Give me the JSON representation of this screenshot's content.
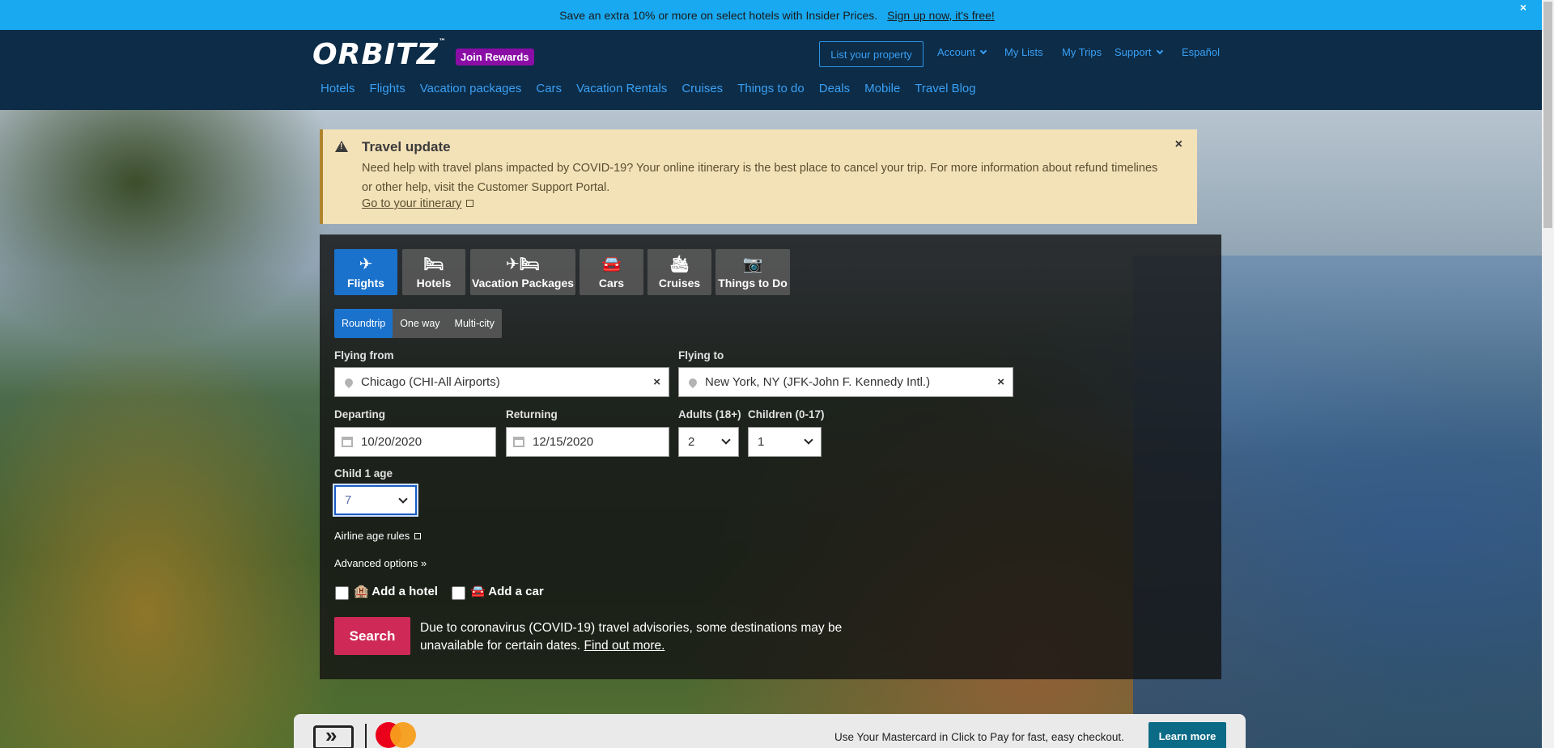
{
  "promo": {
    "text": "Save an extra 10% or more on select hotels with Insider Prices.",
    "link": "Sign up now, it's free!",
    "close": "×"
  },
  "header": {
    "logo": "ORBITZ",
    "logo_tm": "™",
    "join_rewards": "Join Rewards",
    "list_property": "List your property",
    "links": [
      "Account",
      "My Lists",
      "My Trips",
      "Support",
      "Español"
    ],
    "nav": [
      "Hotels",
      "Flights",
      "Vacation packages",
      "Cars",
      "Vacation Rentals",
      "Cruises",
      "Things to do",
      "Deals",
      "Mobile",
      "Travel Blog"
    ]
  },
  "alert": {
    "title": "Travel update",
    "message": "Need help with travel plans impacted by COVID-19? Your online itinerary is the best place to cancel your trip. For more information about refund timelines or other help, visit the Customer Support Portal.",
    "link": "Go to your itinerary",
    "close": "×"
  },
  "search": {
    "tabs": [
      {
        "label": "Flights",
        "icon": "✈"
      },
      {
        "label": "Hotels",
        "icon": "🛏"
      },
      {
        "label": "Vacation Packages",
        "icon": "✈🛏"
      },
      {
        "label": "Cars",
        "icon": "🚘"
      },
      {
        "label": "Cruises",
        "icon": "🛳"
      },
      {
        "label": "Things to Do",
        "icon": "📷"
      }
    ],
    "trip_types": [
      "Roundtrip",
      "One way",
      "Multi-city"
    ],
    "flying_from_label": "Flying from",
    "flying_from_value": "Chicago (CHI-All Airports)",
    "flying_to_label": "Flying to",
    "flying_to_value": "New York, NY (JFK-John F. Kennedy Intl.)",
    "departing_label": "Departing",
    "departing_value": "10/20/2020",
    "returning_label": "Returning",
    "returning_value": "12/15/2020",
    "adults_label": "Adults (18+)",
    "adults_value": "2",
    "children_label": "Children (0-17)",
    "children_value": "1",
    "child_age_label": "Child 1 age",
    "child_age_value": "7",
    "airline_age_rules": "Airline age rules",
    "advanced_options": "Advanced options »",
    "add_hotel": "Add a hotel",
    "add_car": "Add a car",
    "search_button": "Search",
    "covid_note": "Due to coronavirus (COVID-19) travel advisories, some destinations may be unavailable for certain dates.",
    "covid_link": "Find out more."
  },
  "mastercard": {
    "text": "Use Your Mastercard in Click to Pay for fast, easy checkout.",
    "button": "Learn more"
  },
  "colors": {
    "promo": "#18a9f1",
    "header": "#0c2c47",
    "accent_blue": "#1a72cc",
    "search_button": "#cf2a57",
    "alert_bg": "#f3e1b8"
  }
}
